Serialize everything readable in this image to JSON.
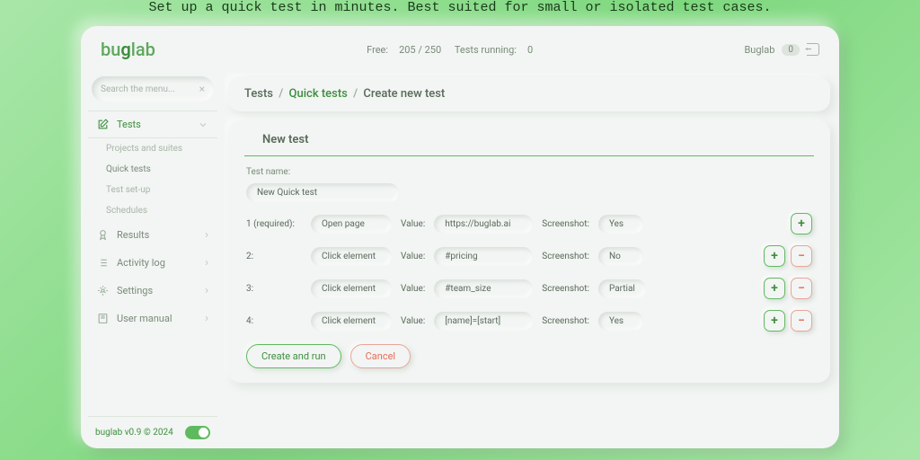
{
  "tagline": "Set up a quick test in minutes. Best suited for small or isolated test cases.",
  "logo": {
    "part1": "bu",
    "part2": "g",
    "part3": "lab"
  },
  "header": {
    "free_label": "Free:",
    "free_value": "205 / 250",
    "running_label": "Tests running:",
    "running_value": "0",
    "account_name": "Buglab",
    "account_badge": "0"
  },
  "search": {
    "placeholder": "Search the menu..."
  },
  "nav": {
    "tests": "Tests",
    "subs": [
      "Projects and suites",
      "Quick tests",
      "Test set-up",
      "Schedules"
    ],
    "active_sub": 1,
    "results": "Results",
    "activity": "Activity log",
    "settings": "Settings",
    "manual": "User manual"
  },
  "footer": {
    "text": "buglab v0.9 © 2024"
  },
  "breadcrumbs": {
    "a": "Tests",
    "b": "Quick tests",
    "c": "Create new test"
  },
  "card": {
    "title": "New test",
    "name_label": "Test name:",
    "name_value": "New Quick test",
    "col_value": "Value:",
    "col_shot": "Screenshot:",
    "steps": [
      {
        "label": "1 (required):",
        "action": "Open page",
        "value": "https://buglab.ai",
        "shot": "Yes",
        "add": true,
        "rem": false
      },
      {
        "label": "2:",
        "action": "Click element",
        "value": "#pricing",
        "shot": "No",
        "add": true,
        "rem": true
      },
      {
        "label": "3:",
        "action": "Click element",
        "value": "#team_size",
        "shot": "Partial",
        "add": true,
        "rem": true
      },
      {
        "label": "4:",
        "action": "Click element",
        "value": "[name]=[start]",
        "shot": "Yes",
        "add": true,
        "rem": true
      }
    ],
    "create_btn": "Create and run",
    "cancel_btn": "Cancel"
  }
}
